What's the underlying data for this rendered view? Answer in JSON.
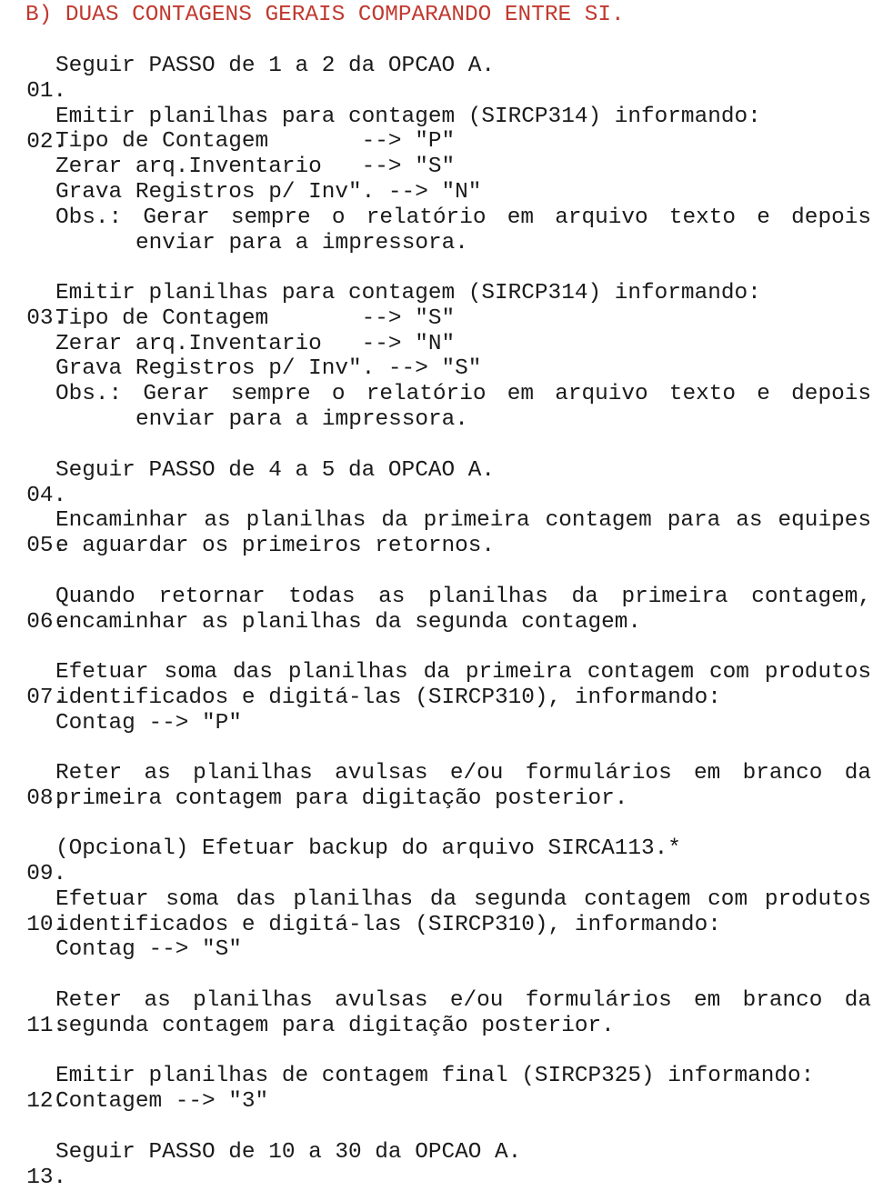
{
  "heading": "B) DUAS CONTAGENS GERAIS COMPARANDO ENTRE SI.",
  "steps": [
    {
      "num": "01.",
      "lines": [
        "Seguir PASSO de 1 a 2 da OPCAO A."
      ]
    },
    {
      "num": "02.",
      "lines": [
        "Emitir planilhas para contagem (SIRCP314) informando:",
        "Tipo de Contagem       --> \"P\"",
        "Zerar arq.Inventario   --> \"S\"",
        "Grava Registros p/ Inv\". --> \"N\"",
        "Obs.: Gerar sempre o relatório em arquivo texto e depois",
        "enviar para a impressora."
      ]
    },
    {
      "num": "03.",
      "lines": [
        "Emitir planilhas para contagem (SIRCP314) informando:",
        "Tipo de Contagem       --> \"S\"",
        "Zerar arq.Inventario   --> \"N\"",
        "Grava Registros p/ Inv\". --> \"S\"",
        "Obs.: Gerar sempre o relatório em arquivo texto e depois",
        "enviar para a impressora."
      ]
    },
    {
      "num": "04.",
      "lines": [
        "Seguir PASSO de 4 a 5 da OPCAO A."
      ]
    },
    {
      "num": "05.",
      "lines": [
        "Encaminhar as planilhas da primeira contagem para as equipes",
        "e aguardar os primeiros retornos."
      ]
    },
    {
      "num": "06.",
      "lines": [
        "Quando retornar todas as planilhas da primeira contagem,",
        "encaminhar as planilhas da segunda contagem."
      ]
    },
    {
      "num": "07.",
      "lines": [
        "Efetuar soma das planilhas da primeira contagem com produtos",
        "identificados e digitá-las (SIRCP310), informando:",
        "Contag --> \"P\""
      ]
    },
    {
      "num": "08.",
      "lines": [
        "Reter as planilhas avulsas e/ou formulários em branco da",
        "primeira contagem para digitação posterior."
      ]
    },
    {
      "num": "09.",
      "lines": [
        "(Opcional) Efetuar backup do arquivo SIRCA113.*"
      ]
    },
    {
      "num": "10.",
      "lines": [
        "Efetuar soma das planilhas da segunda contagem com produtos",
        "identificados e digitá-las (SIRCP310), informando:",
        "Contag --> \"S\""
      ]
    },
    {
      "num": "11.",
      "lines": [
        "Reter as planilhas avulsas e/ou formulários em branco da",
        "segunda contagem para digitação posterior."
      ]
    },
    {
      "num": "12.",
      "lines": [
        "Emitir planilhas de contagem final (SIRCP325) informando:",
        "Contagem --> \"3\""
      ]
    },
    {
      "num": "13.",
      "lines": [
        "Seguir PASSO de 10 a 30 da OPCAO A."
      ]
    }
  ]
}
